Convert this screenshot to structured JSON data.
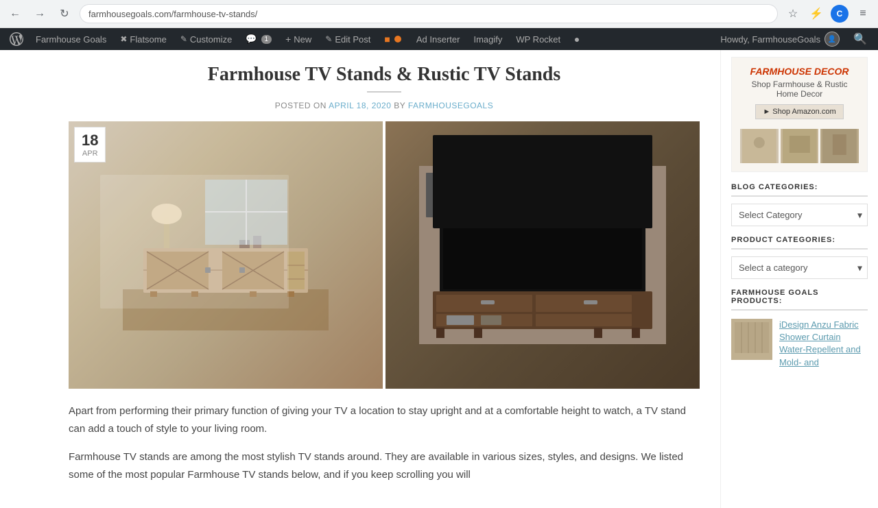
{
  "browser": {
    "url": "farmhousegoals.com/farmhouse-tv-stands/",
    "nav": {
      "back": "←",
      "forward": "→",
      "reload": "↻"
    },
    "toolbar_icons": [
      "☆",
      "⚡",
      "≡"
    ],
    "profile_initial": "C"
  },
  "wp_admin_bar": {
    "logo_title": "WordPress",
    "items": [
      {
        "label": "Farmhouse Goals",
        "type": "site"
      },
      {
        "label": "Flatsome",
        "type": "theme"
      },
      {
        "label": "Customize",
        "type": "customize"
      },
      {
        "label": "1",
        "type": "comments",
        "badge": "1"
      },
      {
        "label": "New",
        "type": "new"
      },
      {
        "label": "Edit Post",
        "type": "edit"
      },
      {
        "label": "",
        "type": "dot"
      },
      {
        "label": "Ad Inserter",
        "type": "plugin"
      },
      {
        "label": "Imagify",
        "type": "plugin"
      },
      {
        "label": "WP Rocket",
        "type": "plugin"
      }
    ],
    "howdy": "Howdy, FarmhouseGoals"
  },
  "post": {
    "title": "Farmhouse TV Stands & Rustic TV Stands",
    "meta_prefix": "POSTED ON",
    "date": "APRIL 18, 2020",
    "author_prefix": "BY",
    "author": "FARMHOUSEGOALS",
    "date_badge_day": "18",
    "date_badge_month": "Apr"
  },
  "body_text": {
    "paragraph1": "Apart from performing their primary function of giving your TV a location to stay upright and at a comfortable height to watch, a TV stand can add a touch of style to your living room.",
    "paragraph2": "Farmhouse TV stands are among the most stylish TV stands around. They are available in various sizes, styles, and designs. We listed some of the most popular Farmhouse TV stands below, and if you keep scrolling you will"
  },
  "sidebar": {
    "ad": {
      "title": "FARMHOUSE DECOR",
      "subtitle": "Shop Farmhouse & Rustic Home Decor",
      "button_label": "► Shop Amazon.com"
    },
    "blog_categories": {
      "section_title": "BLOG CATEGORIES:",
      "select_label": "Select Category",
      "select_default": "Select Category"
    },
    "product_categories": {
      "section_title": "PRODUCT CATEGORIES:",
      "select_label": "Select a category",
      "select_default": "Select a category"
    },
    "farmhouse_products": {
      "section_title": "FARMHOUSE GOALS PRODUCTS:",
      "product": {
        "title": "iDesign Anzu Fabric Shower Curtain Water-Repellent and Mold- and"
      }
    }
  }
}
